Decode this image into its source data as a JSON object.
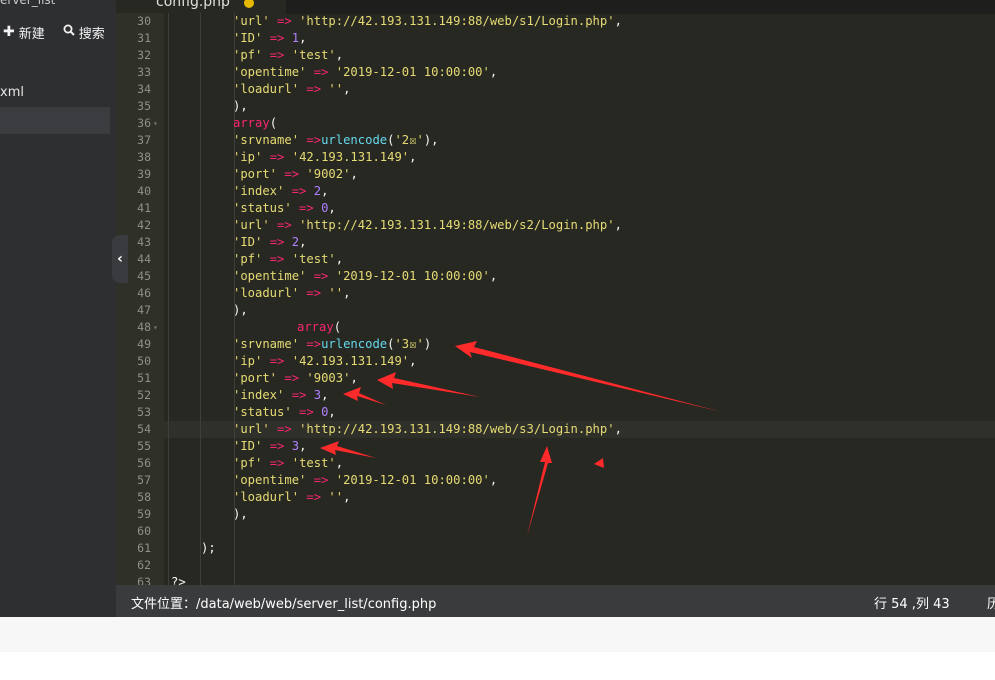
{
  "sidebar": {
    "header_title": "erver_list",
    "new_label": "新建",
    "search_label": "搜索",
    "file_item": "xml"
  },
  "tab": {
    "label": "config.php"
  },
  "statusbar": {
    "path": "文件位置：/data/web/web/server_list/config.php",
    "cursor": "行 54 ,列 43",
    "cut": "历"
  },
  "code_lines": [
    {
      "n": 30,
      "html": "<span class='str'>'url'</span> <span class='op'>=&gt;</span> <span class='str'>'http://42.193.131.149:88/web/s1/Login.php'</span><span class='pun'>,</span>"
    },
    {
      "n": 31,
      "html": "<span class='str'>'ID'</span> <span class='op'>=&gt;</span> <span class='num'>1</span><span class='pun'>,</span>"
    },
    {
      "n": 32,
      "html": "<span class='str'>'pf'</span> <span class='op'>=&gt;</span> <span class='str'>'test'</span><span class='pun'>,</span>"
    },
    {
      "n": 33,
      "html": "<span class='str'>'opentime'</span> <span class='op'>=&gt;</span> <span class='str'>'2019-12-01 10:00:00'</span><span class='pun'>,</span>"
    },
    {
      "n": 34,
      "html": "<span class='str'>'loadurl'</span> <span class='op'>=&gt;</span> <span class='str'>''</span><span class='pun'>,</span>"
    },
    {
      "n": 35,
      "html": "<span class='pun'>),</span>"
    },
    {
      "n": 36,
      "html": "<span class='kw'>array</span><span class='pun'>(</span>",
      "fold": true
    },
    {
      "n": 37,
      "html": "<span class='str'>'srvname'</span> <span class='op'>=&gt;</span><span class='fn'>urlencode</span><span class='pun'>(</span><span class='str'>'2☒'</span><span class='pun'>),</span>"
    },
    {
      "n": 38,
      "html": "<span class='str'>'ip'</span> <span class='op'>=&gt;</span> <span class='str'>'42.193.131.149'</span><span class='pun'>,</span>"
    },
    {
      "n": 39,
      "html": "<span class='str'>'port'</span> <span class='op'>=&gt;</span> <span class='str'>'9002'</span><span class='pun'>,</span>"
    },
    {
      "n": 40,
      "html": "<span class='str'>'index'</span> <span class='op'>=&gt;</span> <span class='num'>2</span><span class='pun'>,</span>"
    },
    {
      "n": 41,
      "html": "<span class='str'>'status'</span> <span class='op'>=&gt;</span> <span class='num'>0</span><span class='pun'>,</span>"
    },
    {
      "n": 42,
      "html": "<span class='str'>'url'</span> <span class='op'>=&gt;</span> <span class='str'>'http://42.193.131.149:88/web/s2/Login.php'</span><span class='pun'>,</span>"
    },
    {
      "n": 43,
      "html": "<span class='str'>'ID'</span> <span class='op'>=&gt;</span> <span class='num'>2</span><span class='pun'>,</span>"
    },
    {
      "n": 44,
      "html": "<span class='str'>'pf'</span> <span class='op'>=&gt;</span> <span class='str'>'test'</span><span class='pun'>,</span>"
    },
    {
      "n": 45,
      "html": "<span class='str'>'opentime'</span> <span class='op'>=&gt;</span> <span class='str'>'2019-12-01 10:00:00'</span><span class='pun'>,</span>"
    },
    {
      "n": 46,
      "html": "<span class='str'>'loadurl'</span> <span class='op'>=&gt;</span> <span class='str'>''</span><span class='pun'>,</span>"
    },
    {
      "n": 47,
      "html": "<span class='pun'>),</span>"
    },
    {
      "n": 48,
      "html": "<span class='kw'>array</span><span class='pun'>(</span>",
      "fold": true,
      "indent": "deep"
    },
    {
      "n": 49,
      "html": "<span class='str'>'srvname'</span> <span class='op'>=&gt;</span><span class='fn'>urlencode</span><span class='pun'>(</span><span class='str'>'3☒'</span><span class='pun'>)</span>"
    },
    {
      "n": 50,
      "html": "<span class='str'>'ip'</span> <span class='op'>=&gt;</span> <span class='str'>'42.193.131.149'</span><span class='pun'>,</span>"
    },
    {
      "n": 51,
      "html": "<span class='str'>'port'</span> <span class='op'>=&gt;</span> <span class='str'>'9003'</span><span class='pun'>,</span>"
    },
    {
      "n": 52,
      "html": "<span class='str'>'index'</span> <span class='op'>=&gt;</span> <span class='num'>3</span><span class='pun'>,</span>"
    },
    {
      "n": 53,
      "html": "<span class='str'>'status'</span> <span class='op'>=&gt;</span> <span class='num'>0</span><span class='pun'>,</span>"
    },
    {
      "n": 54,
      "html": "<span class='str'>'url'</span> <span class='op'>=&gt;</span> <span class='str'>'http://42.193.131.149:88/web/s3/Login.php'</span><span class='pun'>,</span>",
      "active": true
    },
    {
      "n": 55,
      "html": "<span class='str'>'ID'</span> <span class='op'>=&gt;</span> <span class='num'>3</span><span class='pun'>,</span>"
    },
    {
      "n": 56,
      "html": "<span class='str'>'pf'</span> <span class='op'>=&gt;</span> <span class='str'>'test'</span><span class='pun'>,</span>"
    },
    {
      "n": 57,
      "html": "<span class='str'>'opentime'</span> <span class='op'>=&gt;</span> <span class='str'>'2019-12-01 10:00:00'</span><span class='pun'>,</span>"
    },
    {
      "n": 58,
      "html": "<span class='str'>'loadurl'</span> <span class='op'>=&gt;</span> <span class='str'>''</span><span class='pun'>,</span>"
    },
    {
      "n": 59,
      "html": "<span class='pun'>),</span>"
    },
    {
      "n": 60,
      "html": ""
    },
    {
      "n": 61,
      "html": "<span class='pun'>);</span>",
      "indent": "outer"
    },
    {
      "n": 62,
      "html": ""
    },
    {
      "n": 63,
      "html": "<span class='pun'>?&gt;</span>",
      "indent": "none"
    }
  ],
  "colors": {
    "editor_bg": "#272822",
    "sidebar_bg": "#2e2f31",
    "statusbar_bg": "#3a3b3d",
    "annotation_red": "#ff2a2a"
  }
}
